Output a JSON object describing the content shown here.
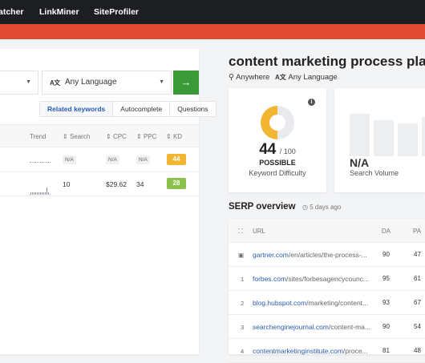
{
  "topnav": {
    "links": [
      "atcher",
      "LinkMiner",
      "SiteProfiler"
    ]
  },
  "search": {
    "language": "Any Language",
    "go_label": "→"
  },
  "keyword_tabs": [
    "Related keywords",
    "Autocomplete",
    "Questions"
  ],
  "table": {
    "headers": [
      "Trend",
      "Search",
      "CPC",
      "PPC",
      "KD"
    ],
    "rows": [
      {
        "search": "N/A",
        "cpc": "N/A",
        "ppc": "N/A",
        "kd": "44",
        "kd_color": "#f2b632",
        "trend": [
          0,
          0,
          0,
          0,
          0,
          0,
          0,
          0,
          0,
          0,
          0,
          0
        ]
      },
      {
        "search": "10",
        "cpc": "$29.62",
        "ppc": "34",
        "kd": "28",
        "kd_color": "#8bc34a",
        "trend": [
          2,
          2,
          2,
          2,
          2,
          2,
          2,
          2,
          2,
          2,
          8,
          2
        ]
      }
    ]
  },
  "keyword": {
    "title": "content marketing process plan",
    "location": "Anywhere",
    "language": "Any Language"
  },
  "difficulty": {
    "value": "44",
    "max": "/ 100",
    "level": "POSSIBLE",
    "label": "Keyword Difficulty",
    "fraction": 0.44
  },
  "volume": {
    "value": "N/A",
    "label": "Search Volume"
  },
  "serp": {
    "title": "SERP overview",
    "time": "5 days ago",
    "headers": {
      "url": "URL",
      "da": "DA",
      "pa": "PA"
    },
    "rows": [
      {
        "index": "",
        "domain": "gartner.com",
        "path": "/en/articles/the-process-...",
        "da": "90",
        "pa": "47"
      },
      {
        "index": "1",
        "domain": "forbes.com",
        "path": "/sites/forbesagencycounc...",
        "da": "95",
        "pa": "61"
      },
      {
        "index": "2",
        "domain": "blog.hubspot.com",
        "path": "/marketing/content...",
        "da": "93",
        "pa": "67"
      },
      {
        "index": "3",
        "domain": "searchenginejournal.com",
        "path": "/content-ma...",
        "da": "90",
        "pa": "54"
      },
      {
        "index": "4",
        "domain": "contentmarketinginstitute.com",
        "path": "/proce...",
        "da": "81",
        "pa": "48"
      }
    ]
  }
}
